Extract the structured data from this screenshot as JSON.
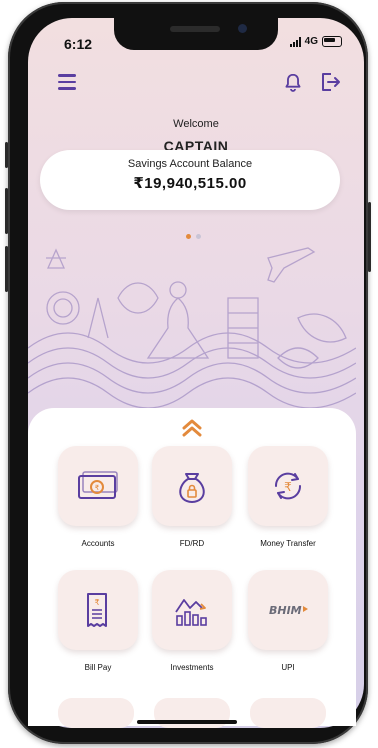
{
  "status": {
    "time": "6:12",
    "network": "4G"
  },
  "header": {
    "menu_icon": "hamburger-icon",
    "bell_icon": "bell-icon",
    "logout_icon": "logout-icon"
  },
  "welcome": {
    "greeting": "Welcome",
    "user_name": "CAPTAIN"
  },
  "balance": {
    "label": "Savings Account Balance",
    "amount": "₹19,940,515.00"
  },
  "carousel": {
    "pages": 2,
    "active": 1
  },
  "colors": {
    "accent": "#5a3ea0",
    "orange": "#e38a3c",
    "tile": "#f8ecea"
  },
  "services": [
    {
      "label": "Accounts",
      "icon": "cash-icon"
    },
    {
      "label": "FD/RD",
      "icon": "money-bag-icon"
    },
    {
      "label": "Money Transfer",
      "icon": "transfer-icon"
    },
    {
      "label": "Bill Pay",
      "icon": "bill-icon"
    },
    {
      "label": "Investments",
      "icon": "investments-icon"
    },
    {
      "label": "UPI",
      "icon": "upi-icon"
    }
  ],
  "upi_logo": "BHIM"
}
